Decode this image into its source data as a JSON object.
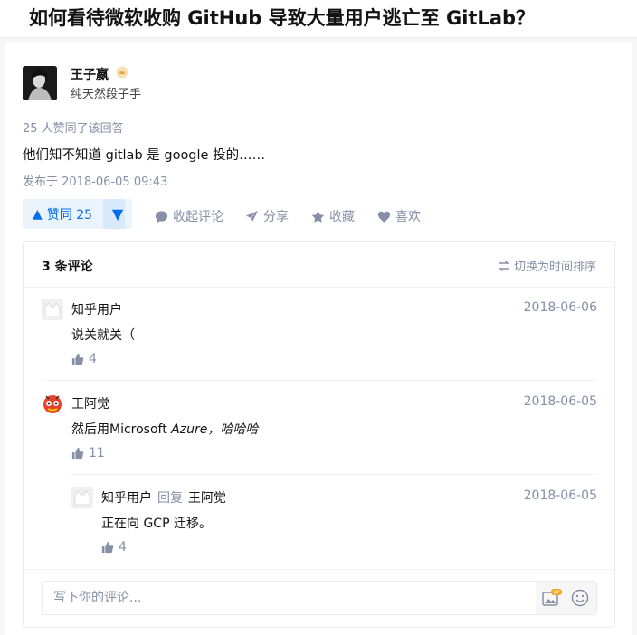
{
  "question": {
    "title": "如何看待微软收购 GitHub 导致大量用户逃亡至 GitLab？"
  },
  "answer": {
    "author_name": "王子嬴",
    "author_bio": "纯天然段子手",
    "voter_text": "25 人赞同了该回答",
    "content": "他们知不知道 gitlab 是 google 投的……",
    "publish_time": "发布于 2018-06-05 09:43",
    "vote_up_label": "赞同 25",
    "actions": {
      "collapse_comments": "收起评论",
      "share": "分享",
      "favorite": "收藏",
      "like": "喜欢"
    }
  },
  "comments": {
    "count_label": "3 条评论",
    "sort_label": "切换为时间排序",
    "items": [
      {
        "author": "知乎用户",
        "date": "2018-06-06",
        "text": "说关就关（",
        "likes": "4"
      },
      {
        "author": "王阿觉",
        "date": "2018-06-05",
        "text_plain": "然后用Microsoft ",
        "text_italic": "Azure",
        "text_tail": "，哈哈哈",
        "likes": "11"
      },
      {
        "author": "知乎用户",
        "reply_word": "回复",
        "reply_to": "王阿觉",
        "date": "2018-06-05",
        "text": "正在向 GCP 迁移。",
        "likes": "4"
      }
    ],
    "input_placeholder": "写下你的评论...",
    "vip_label": "VIP"
  },
  "colors": {
    "accent": "#056de8",
    "muted": "#8590a6"
  }
}
